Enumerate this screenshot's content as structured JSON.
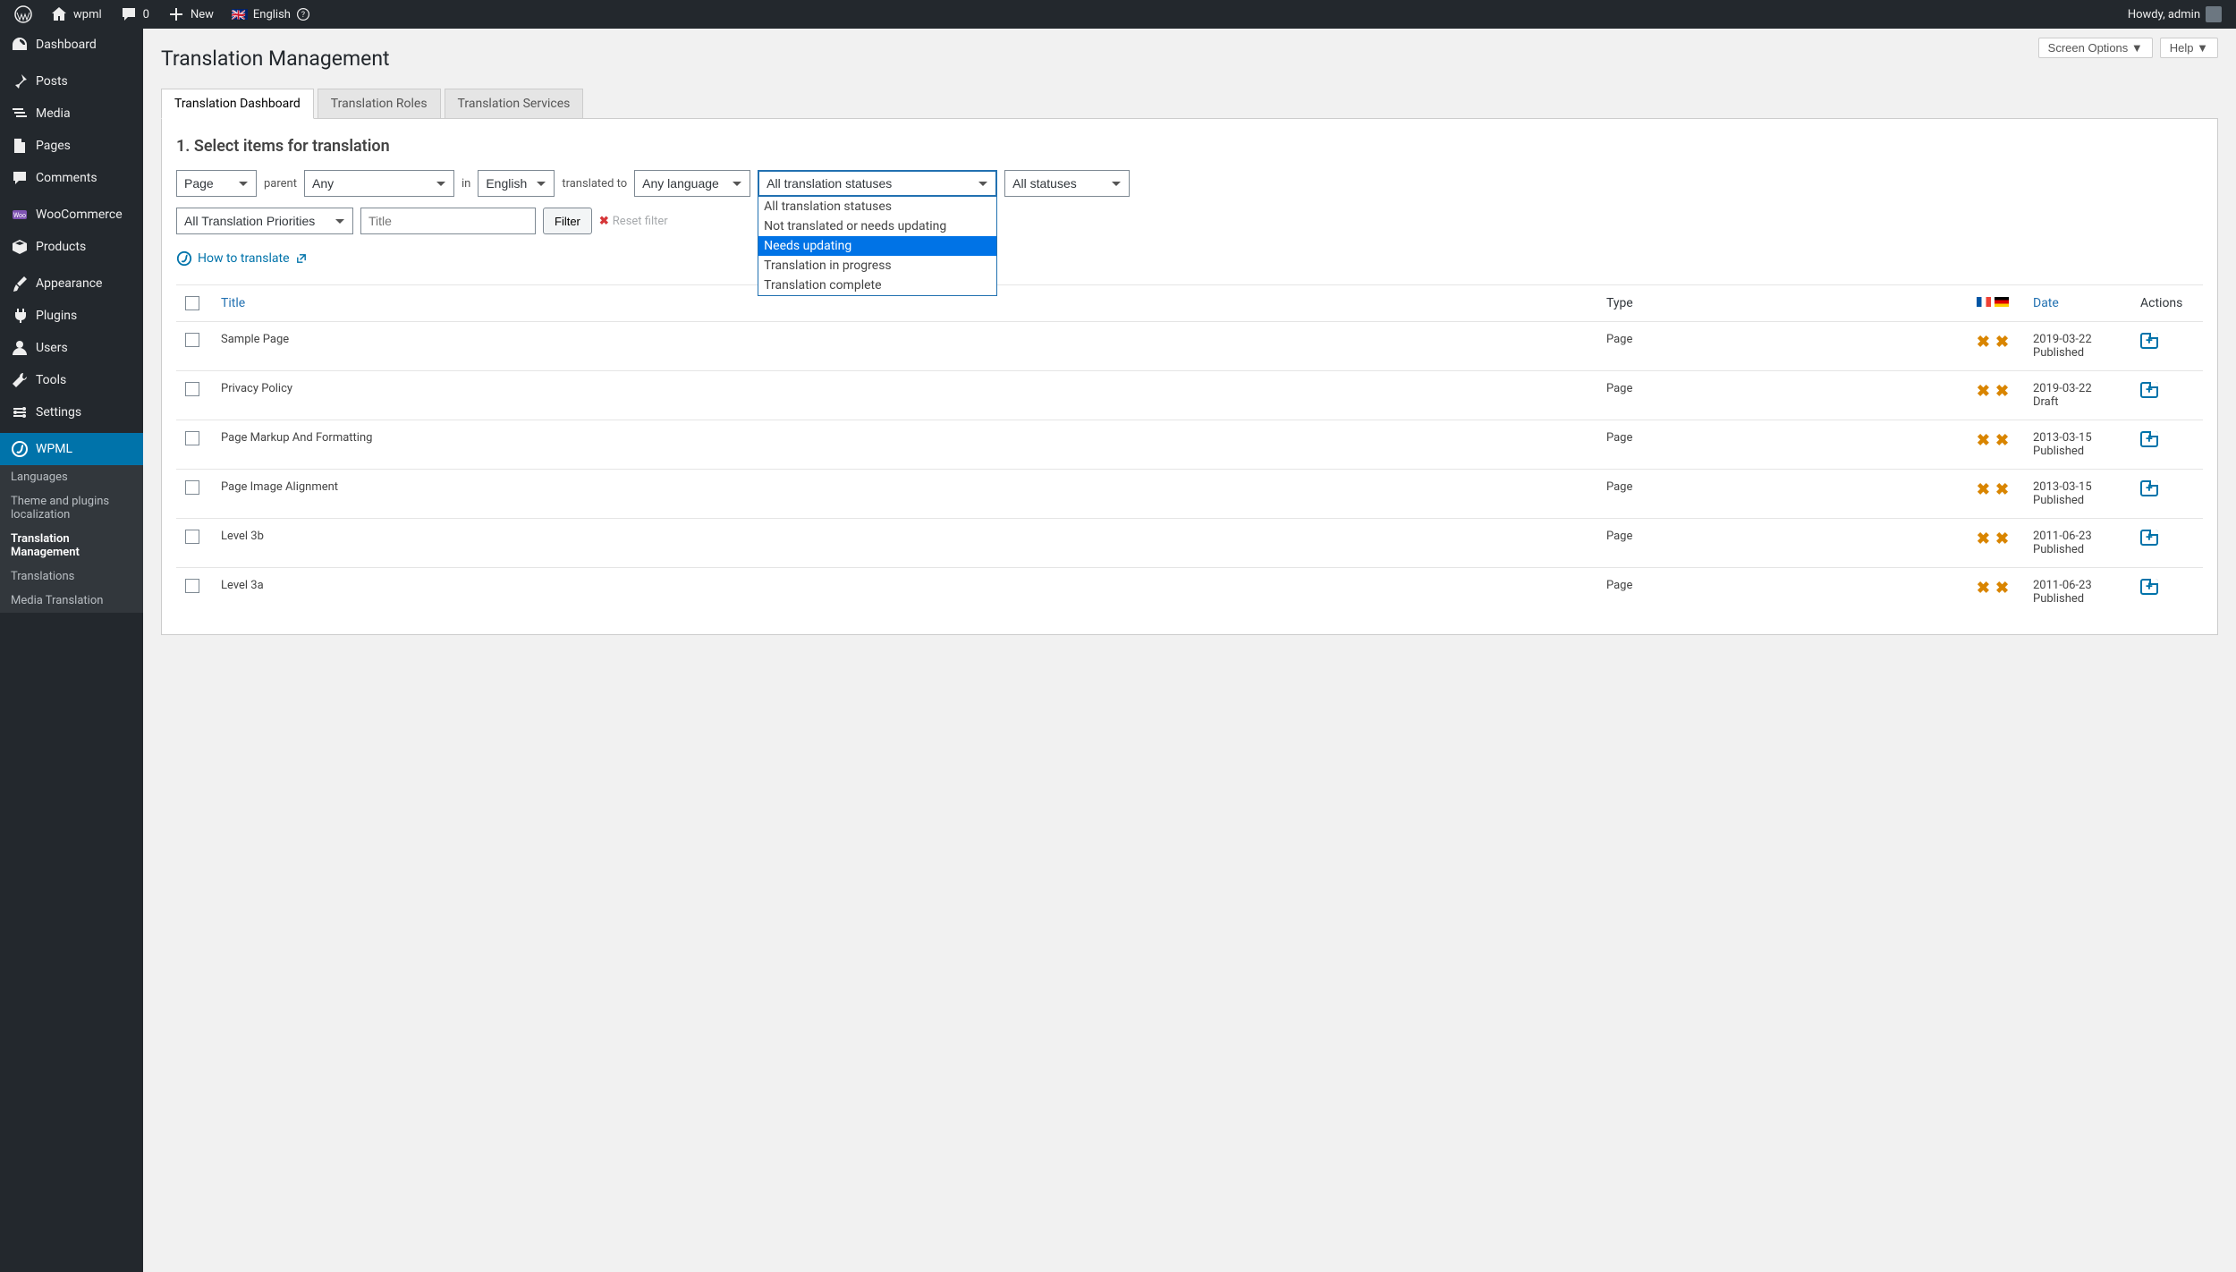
{
  "topbar": {
    "site_name": "wpml",
    "comments_count": "0",
    "new_label": "New",
    "language": "English",
    "howdy": "Howdy, admin"
  },
  "sidebar": {
    "dashboard": "Dashboard",
    "posts": "Posts",
    "media": "Media",
    "pages": "Pages",
    "comments": "Comments",
    "woocommerce": "WooCommerce",
    "products": "Products",
    "appearance": "Appearance",
    "plugins": "Plugins",
    "users": "Users",
    "tools": "Tools",
    "settings": "Settings",
    "wpml": "WPML",
    "sub_languages": "Languages",
    "sub_theme": "Theme and plugins localization",
    "sub_tm": "Translation Management",
    "sub_translations": "Translations",
    "sub_media": "Media Translation"
  },
  "top_actions": {
    "screen_options": "Screen Options",
    "help": "Help"
  },
  "page_title": "Translation Management",
  "tabs": {
    "dashboard": "Translation Dashboard",
    "roles": "Translation Roles",
    "services": "Translation Services"
  },
  "section_title": "1. Select items for translation",
  "filters": {
    "type_value": "Page",
    "parent_label": "parent",
    "parent_value": "Any",
    "in_label": "in",
    "in_value": "English",
    "translated_to_label": "translated to",
    "translated_to_value": "Any language",
    "status_value": "All translation statuses",
    "status2_value": "All statuses",
    "priority_value": "All Translation Priorities",
    "title_placeholder": "Title",
    "filter_btn": "Filter",
    "reset_filter": "Reset filter",
    "howto": "How to translate"
  },
  "status_options": {
    "opt0": "All translation statuses",
    "opt1": "Not translated or needs updating",
    "opt2": "Needs updating",
    "opt3": "Translation in progress",
    "opt4": "Translation complete"
  },
  "columns": {
    "title": "Title",
    "type": "Type",
    "date": "Date",
    "actions": "Actions"
  },
  "rows": {
    "r0": {
      "title": "Sample Page",
      "type": "Page",
      "date": "2019-03-22",
      "status": "Published"
    },
    "r1": {
      "title": "Privacy Policy",
      "type": "Page",
      "date": "2019-03-22",
      "status": "Draft"
    },
    "r2": {
      "title": "Page Markup And Formatting",
      "type": "Page",
      "date": "2013-03-15",
      "status": "Published"
    },
    "r3": {
      "title": "Page Image Alignment",
      "type": "Page",
      "date": "2013-03-15",
      "status": "Published"
    },
    "r4": {
      "title": "Level 3b",
      "type": "Page",
      "date": "2011-06-23",
      "status": "Published"
    },
    "r5": {
      "title": "Level 3a",
      "type": "Page",
      "date": "2011-06-23",
      "status": "Published"
    }
  }
}
